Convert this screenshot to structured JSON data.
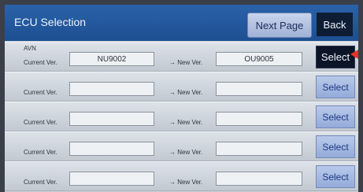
{
  "header": {
    "title": "ECU Selection",
    "next_page_label": "Next Page",
    "back_label": "Back"
  },
  "rows": [
    {
      "ecu_name": "AVN",
      "current_label": "Current Ver.",
      "current_value": "NU9002",
      "new_label": "→ New Ver.",
      "new_value": "OU9005",
      "select_label": "Select"
    },
    {
      "ecu_name": "",
      "current_label": "Current Ver.",
      "current_value": "",
      "new_label": "→ New Ver.",
      "new_value": "",
      "select_label": "Select"
    },
    {
      "ecu_name": "",
      "current_label": "Current Ver.",
      "current_value": "",
      "new_label": "→ New Ver.",
      "new_value": "",
      "select_label": "Select"
    },
    {
      "ecu_name": "",
      "current_label": "Current Ver.",
      "current_value": "",
      "new_label": "→ New Ver.",
      "new_value": "",
      "select_label": "Select"
    },
    {
      "ecu_name": "",
      "current_label": "Current Ver.",
      "current_value": "",
      "new_label": "→ New Ver.",
      "new_value": "",
      "select_label": "Select"
    }
  ],
  "colors": {
    "header_blue": "#2a62a8",
    "select_active": "#0c1527",
    "select_inactive": "#b9c9ea",
    "pointer_arrow": "#e8322a"
  },
  "icons": {
    "pointer": "red-arrow-icon"
  }
}
